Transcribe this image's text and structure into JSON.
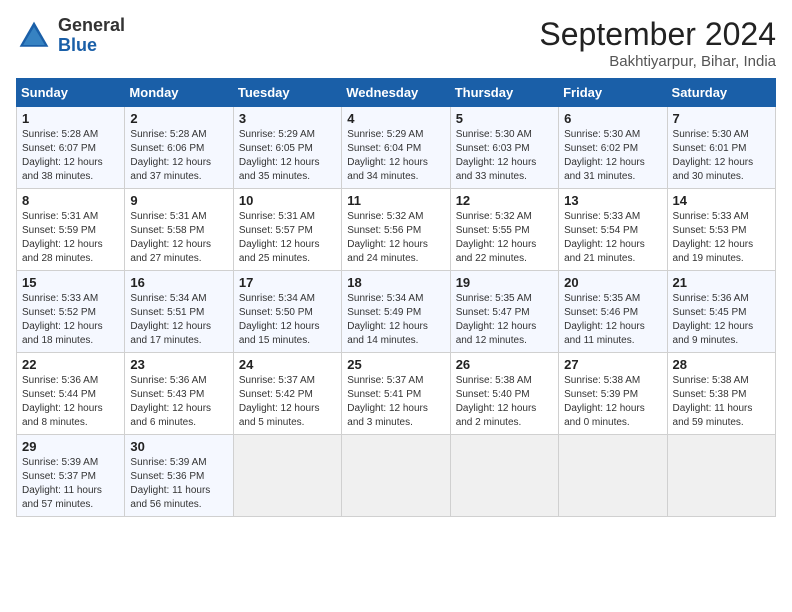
{
  "header": {
    "logo_line1": "General",
    "logo_line2": "Blue",
    "month_title": "September 2024",
    "location": "Bakhtiyarpur, Bihar, India"
  },
  "weekdays": [
    "Sunday",
    "Monday",
    "Tuesday",
    "Wednesday",
    "Thursday",
    "Friday",
    "Saturday"
  ],
  "weeks": [
    [
      {
        "day": 1,
        "sunrise": "5:28 AM",
        "sunset": "6:07 PM",
        "daylight": "12 hours and 38 minutes."
      },
      {
        "day": 2,
        "sunrise": "5:28 AM",
        "sunset": "6:06 PM",
        "daylight": "12 hours and 37 minutes."
      },
      {
        "day": 3,
        "sunrise": "5:29 AM",
        "sunset": "6:05 PM",
        "daylight": "12 hours and 35 minutes."
      },
      {
        "day": 4,
        "sunrise": "5:29 AM",
        "sunset": "6:04 PM",
        "daylight": "12 hours and 34 minutes."
      },
      {
        "day": 5,
        "sunrise": "5:30 AM",
        "sunset": "6:03 PM",
        "daylight": "12 hours and 33 minutes."
      },
      {
        "day": 6,
        "sunrise": "5:30 AM",
        "sunset": "6:02 PM",
        "daylight": "12 hours and 31 minutes."
      },
      {
        "day": 7,
        "sunrise": "5:30 AM",
        "sunset": "6:01 PM",
        "daylight": "12 hours and 30 minutes."
      }
    ],
    [
      {
        "day": 8,
        "sunrise": "5:31 AM",
        "sunset": "5:59 PM",
        "daylight": "12 hours and 28 minutes."
      },
      {
        "day": 9,
        "sunrise": "5:31 AM",
        "sunset": "5:58 PM",
        "daylight": "12 hours and 27 minutes."
      },
      {
        "day": 10,
        "sunrise": "5:31 AM",
        "sunset": "5:57 PM",
        "daylight": "12 hours and 25 minutes."
      },
      {
        "day": 11,
        "sunrise": "5:32 AM",
        "sunset": "5:56 PM",
        "daylight": "12 hours and 24 minutes."
      },
      {
        "day": 12,
        "sunrise": "5:32 AM",
        "sunset": "5:55 PM",
        "daylight": "12 hours and 22 minutes."
      },
      {
        "day": 13,
        "sunrise": "5:33 AM",
        "sunset": "5:54 PM",
        "daylight": "12 hours and 21 minutes."
      },
      {
        "day": 14,
        "sunrise": "5:33 AM",
        "sunset": "5:53 PM",
        "daylight": "12 hours and 19 minutes."
      }
    ],
    [
      {
        "day": 15,
        "sunrise": "5:33 AM",
        "sunset": "5:52 PM",
        "daylight": "12 hours and 18 minutes."
      },
      {
        "day": 16,
        "sunrise": "5:34 AM",
        "sunset": "5:51 PM",
        "daylight": "12 hours and 17 minutes."
      },
      {
        "day": 17,
        "sunrise": "5:34 AM",
        "sunset": "5:50 PM",
        "daylight": "12 hours and 15 minutes."
      },
      {
        "day": 18,
        "sunrise": "5:34 AM",
        "sunset": "5:49 PM",
        "daylight": "12 hours and 14 minutes."
      },
      {
        "day": 19,
        "sunrise": "5:35 AM",
        "sunset": "5:47 PM",
        "daylight": "12 hours and 12 minutes."
      },
      {
        "day": 20,
        "sunrise": "5:35 AM",
        "sunset": "5:46 PM",
        "daylight": "12 hours and 11 minutes."
      },
      {
        "day": 21,
        "sunrise": "5:36 AM",
        "sunset": "5:45 PM",
        "daylight": "12 hours and 9 minutes."
      }
    ],
    [
      {
        "day": 22,
        "sunrise": "5:36 AM",
        "sunset": "5:44 PM",
        "daylight": "12 hours and 8 minutes."
      },
      {
        "day": 23,
        "sunrise": "5:36 AM",
        "sunset": "5:43 PM",
        "daylight": "12 hours and 6 minutes."
      },
      {
        "day": 24,
        "sunrise": "5:37 AM",
        "sunset": "5:42 PM",
        "daylight": "12 hours and 5 minutes."
      },
      {
        "day": 25,
        "sunrise": "5:37 AM",
        "sunset": "5:41 PM",
        "daylight": "12 hours and 3 minutes."
      },
      {
        "day": 26,
        "sunrise": "5:38 AM",
        "sunset": "5:40 PM",
        "daylight": "12 hours and 2 minutes."
      },
      {
        "day": 27,
        "sunrise": "5:38 AM",
        "sunset": "5:39 PM",
        "daylight": "12 hours and 0 minutes."
      },
      {
        "day": 28,
        "sunrise": "5:38 AM",
        "sunset": "5:38 PM",
        "daylight": "11 hours and 59 minutes."
      }
    ],
    [
      {
        "day": 29,
        "sunrise": "5:39 AM",
        "sunset": "5:37 PM",
        "daylight": "11 hours and 57 minutes."
      },
      {
        "day": 30,
        "sunrise": "5:39 AM",
        "sunset": "5:36 PM",
        "daylight": "11 hours and 56 minutes."
      },
      null,
      null,
      null,
      null,
      null
    ]
  ]
}
